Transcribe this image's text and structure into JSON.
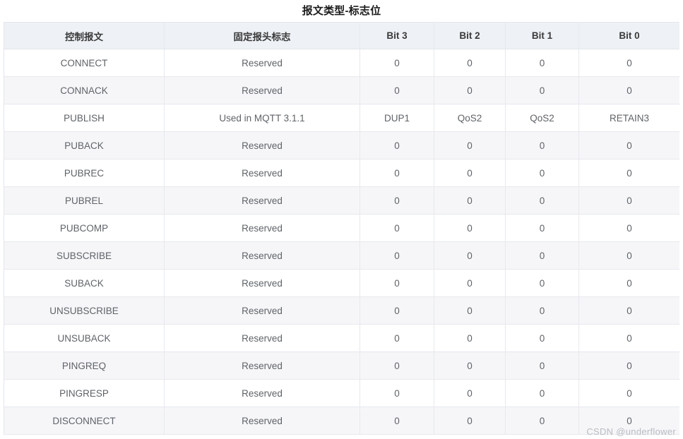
{
  "page": {
    "title": "报文类型-标志位",
    "watermark": "CSDN @underflower"
  },
  "table": {
    "columns": [
      {
        "key": "message",
        "label": "控制报文"
      },
      {
        "key": "fixed_header_flag",
        "label": "固定报头标志"
      },
      {
        "key": "bit3",
        "label": "Bit 3"
      },
      {
        "key": "bit2",
        "label": "Bit 2"
      },
      {
        "key": "bit1",
        "label": "Bit 1"
      },
      {
        "key": "bit0",
        "label": "Bit 0"
      }
    ],
    "rows": [
      {
        "message": "CONNECT",
        "fixed_header_flag": "Reserved",
        "bit3": "0",
        "bit2": "0",
        "bit1": "0",
        "bit0": "0"
      },
      {
        "message": "CONNACK",
        "fixed_header_flag": "Reserved",
        "bit3": "0",
        "bit2": "0",
        "bit1": "0",
        "bit0": "0"
      },
      {
        "message": "PUBLISH",
        "fixed_header_flag": "Used in MQTT 3.1.1",
        "bit3": "DUP1",
        "bit2": "QoS2",
        "bit1": "QoS2",
        "bit0": "RETAIN3"
      },
      {
        "message": "PUBACK",
        "fixed_header_flag": "Reserved",
        "bit3": "0",
        "bit2": "0",
        "bit1": "0",
        "bit0": "0"
      },
      {
        "message": "PUBREC",
        "fixed_header_flag": "Reserved",
        "bit3": "0",
        "bit2": "0",
        "bit1": "0",
        "bit0": "0"
      },
      {
        "message": "PUBREL",
        "fixed_header_flag": "Reserved",
        "bit3": "0",
        "bit2": "0",
        "bit1": "0",
        "bit0": "0"
      },
      {
        "message": "PUBCOMP",
        "fixed_header_flag": "Reserved",
        "bit3": "0",
        "bit2": "0",
        "bit1": "0",
        "bit0": "0"
      },
      {
        "message": "SUBSCRIBE",
        "fixed_header_flag": "Reserved",
        "bit3": "0",
        "bit2": "0",
        "bit1": "0",
        "bit0": "0"
      },
      {
        "message": "SUBACK",
        "fixed_header_flag": "Reserved",
        "bit3": "0",
        "bit2": "0",
        "bit1": "0",
        "bit0": "0"
      },
      {
        "message": "UNSUBSCRIBE",
        "fixed_header_flag": "Reserved",
        "bit3": "0",
        "bit2": "0",
        "bit1": "0",
        "bit0": "0"
      },
      {
        "message": "UNSUBACK",
        "fixed_header_flag": "Reserved",
        "bit3": "0",
        "bit2": "0",
        "bit1": "0",
        "bit0": "0"
      },
      {
        "message": "PINGREQ",
        "fixed_header_flag": "Reserved",
        "bit3": "0",
        "bit2": "0",
        "bit1": "0",
        "bit0": "0"
      },
      {
        "message": "PINGRESP",
        "fixed_header_flag": "Reserved",
        "bit3": "0",
        "bit2": "0",
        "bit1": "0",
        "bit0": "0"
      },
      {
        "message": "DISCONNECT",
        "fixed_header_flag": "Reserved",
        "bit3": "0",
        "bit2": "0",
        "bit1": "0",
        "bit0": "0"
      }
    ]
  },
  "colors": {
    "header_bg": "#eef1f5",
    "row_alt_bg": "#f6f6f8",
    "border": "#e6e9ee",
    "text": "#5f6368",
    "title_text": "#1b1b1b",
    "watermark_text": "#b9bcc2"
  }
}
